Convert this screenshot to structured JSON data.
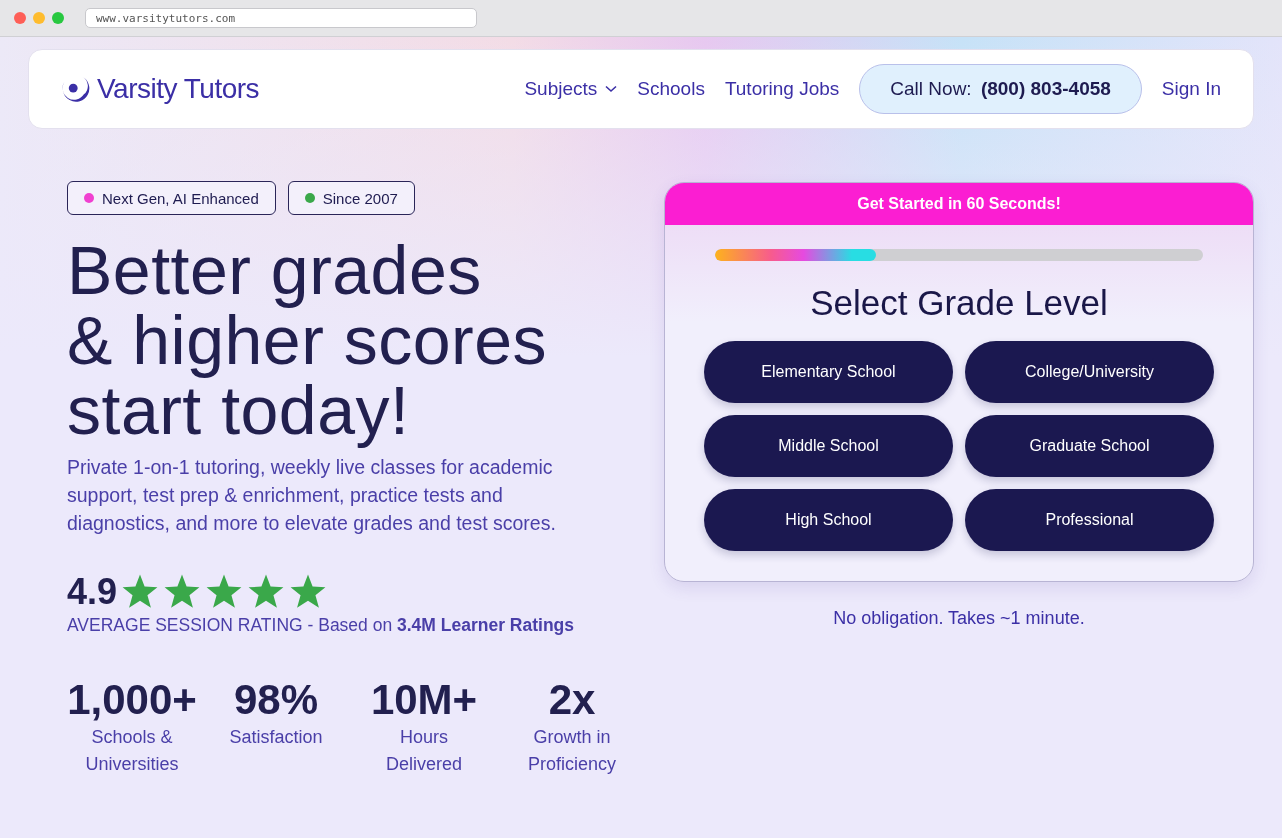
{
  "browser": {
    "url": "www.varsitytutors.com"
  },
  "nav": {
    "logo": "Varsity Tutors",
    "links": [
      {
        "label": "Subjects",
        "dropdown": true
      },
      {
        "label": "Schools",
        "dropdown": false
      },
      {
        "label": "Tutoring Jobs",
        "dropdown": false
      }
    ],
    "call": {
      "label": "Call Now:",
      "phone": "(800) 803-4058"
    },
    "sign_in": "Sign In"
  },
  "badges": [
    {
      "label": "Next Gen, AI Enhanced",
      "color": "#f040d0"
    },
    {
      "label": "Since 2007",
      "color": "#3aa84a"
    }
  ],
  "headline": [
    "Better grades",
    "& higher scores",
    "start today!"
  ],
  "description": "Private 1-on-1 tutoring, weekly live classes for academic support, test prep & enrichment, practice tests and diagnostics, and more to elevate grades and test scores.",
  "rating": {
    "score": "4.9",
    "stars": 5,
    "caption": "AVERAGE SESSION RATING - Based on **3.4M Learner Ratings**"
  },
  "stats": [
    {
      "value": "1,000+",
      "label": "Schools & Universities"
    },
    {
      "value": "98%",
      "label": "Satisfaction"
    },
    {
      "value": "10M+",
      "label": "Hours Delivered"
    },
    {
      "value": "2x",
      "label": "Growth in Proficiency"
    }
  ],
  "signup": {
    "banner": "Get Started in 60 Seconds!",
    "progress": {
      "level": 0.33
    },
    "title": "Select Grade Level",
    "options": [
      "Elementary School",
      "College/University",
      "Middle School",
      "Graduate School",
      "High School",
      "Professional"
    ],
    "note": "No obligation. Takes ~1 minute."
  }
}
